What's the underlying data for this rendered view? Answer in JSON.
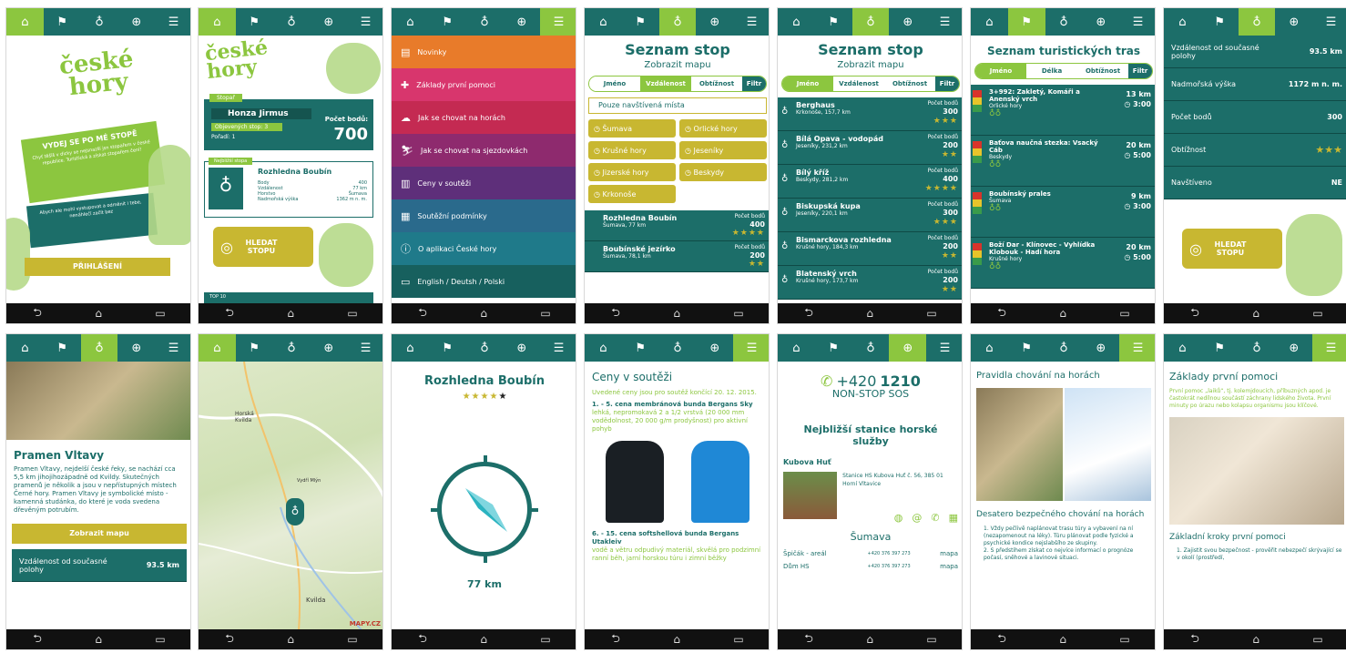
{
  "nav": {
    "icons": [
      "home-icon",
      "tracks-icon",
      "footprint-icon",
      "rescue-icon",
      "menu-icon"
    ]
  },
  "s1": {
    "logo": "české hory",
    "headline": "VYDEJ SE PO MÉ STOPĚ",
    "text1": "Chyť těšíš v dicky se nejsnazší jsn stopařem v české republice. Turistická a získat stopařem čení!",
    "text2": "Abych ale mohl vystupovat a odměnit i tebe, nenáhlečí začít bez",
    "login": "PŘIHLÁŠENÍ"
  },
  "s2": {
    "logo": "české hory",
    "section": "Stopař",
    "name": "Honza Jirmus",
    "found_label": "Objevených stop: 3",
    "rank_label": "Pořadí: 1",
    "points_label": "Počet bodů:",
    "points": "700",
    "card_tag": "Nejbližší stopa",
    "place": "Rozhledna Boubín",
    "rows": [
      [
        "Body",
        "400"
      ],
      [
        "Vzdálenost",
        "77 km"
      ],
      [
        "Horstvo",
        "Šumava"
      ],
      [
        "Nadmořská výška",
        "1362 m n. m."
      ]
    ],
    "search": "HLEDAT STOPU",
    "top": "TOP 10"
  },
  "s3": {
    "menu": [
      {
        "label": "Novinky",
        "color": "#e87b2a"
      },
      {
        "label": "Základy první pomoci",
        "color": "#d8366d"
      },
      {
        "label": "Jak se chovat na horách",
        "color": "#c42a52"
      },
      {
        "label": "Jak se chovat na sjezdovkách",
        "color": "#8e2a6e"
      },
      {
        "label": "Ceny v soutěži",
        "color": "#5e2f7a"
      },
      {
        "label": "Soutěžní podmínky",
        "color": "#2a6a8c"
      },
      {
        "label": "O aplikaci České hory",
        "color": "#1f7a8a"
      },
      {
        "label": "English / Deutsh / Polski",
        "color": "#17605e"
      }
    ]
  },
  "s4": {
    "title": "Seznam stop",
    "map": "Zobrazit mapu",
    "tabs": [
      "Jméno",
      "Vzdálenost",
      "Obtížnost",
      "Filtr"
    ],
    "visited": "Pouze navštívená místa",
    "chips": [
      "Šumava",
      "Orlické hory",
      "Krušné hory",
      "Jeseníky",
      "Jizerské hory",
      "Beskydy",
      "Krkonoše"
    ],
    "items": [
      {
        "name": "Rozhledna Boubín",
        "sub": "Šumava, 77 km",
        "pts_label": "Počet bodů",
        "pts": "400"
      },
      {
        "name": "Boubínské jezírko",
        "sub": "Šumava, 78,1 km",
        "pts_label": "Počet bodů",
        "pts": "200"
      }
    ]
  },
  "s5": {
    "title": "Seznam stop",
    "map": "Zobrazit mapu",
    "tabs": [
      "Jméno",
      "Vzdálenost",
      "Obtížnost",
      "Filtr"
    ],
    "items": [
      {
        "name": "Berghaus",
        "sub": "Krkonoše, 157,7 km",
        "pts_label": "Počet bodů",
        "pts": "300"
      },
      {
        "name": "Bílá Opava - vodopád",
        "sub": "Jeseníky, 231,2 km",
        "pts_label": "Počet bodů",
        "pts": "200"
      },
      {
        "name": "Bílý kříž",
        "sub": "Beskydy, 281,2 km",
        "pts_label": "Počet bodů",
        "pts": "400"
      },
      {
        "name": "Biskupská kupa",
        "sub": "Jeseníky, 220,1 km",
        "pts_label": "Počet bodů",
        "pts": "300"
      },
      {
        "name": "Bismarckova rozhledna",
        "sub": "Krušné hory, 184,3 km",
        "pts_label": "Počet bodů",
        "pts": "200"
      },
      {
        "name": "Blatenský vrch",
        "sub": "Krušné hory, 173,7 km",
        "pts_label": "Počet bodů",
        "pts": "200"
      }
    ]
  },
  "s6": {
    "title": "Seznam turistických tras",
    "tabs": [
      "Jméno",
      "Délka",
      "Obtížnost",
      "Filtr"
    ],
    "items": [
      {
        "name": "3+992: Zakletý, Komáři a Anenský vrch",
        "sub": "Orlické hory",
        "km": "13 km",
        "time": "3:00"
      },
      {
        "name": "Baťova naučná stezka: Vsacký Cáb",
        "sub": "Beskydy",
        "km": "20 km",
        "time": "5:00"
      },
      {
        "name": "Boubínský prales",
        "sub": "Šumava",
        "km": "9 km",
        "time": "3:00"
      },
      {
        "name": "Boží Dar - Klínovec - Vyhlídka Klobouk - Hadí hora",
        "sub": "Krušné hory",
        "km": "20 km",
        "time": "5:00"
      }
    ]
  },
  "s7": {
    "rows": [
      [
        "Vzdálenost od současné polohy",
        "93.5 km"
      ],
      [
        "Nadmořská výška",
        "1172 m n. m."
      ],
      [
        "Počet bodů",
        "300"
      ],
      [
        "Obtížnost",
        "★★★"
      ],
      [
        "Navštíveno",
        "NE"
      ]
    ],
    "search": "HLEDAT STOPU"
  },
  "s8": {
    "title": "Pramen Vltavy",
    "text": "Pramen Vltavy, nejdelší české řeky, se nachází cca 5,5 km jihojihozápadně od Kvildy. Skutečných pramenů je několik a jsou v nepřístupných místech Černé hory. Pramen Vltavy je symbolické místo - kamenná studánka, do které je voda svedena dřevěným potrubím.",
    "map_btn": "Zobrazit mapu",
    "row_label": "Vzdálenost od současné polohy",
    "row_val": "93.5 km"
  },
  "s9": {
    "labels": [
      "Horská Kvilda",
      "Kvilda",
      "Vydří Mlýn"
    ],
    "brand": "MAPY.CZ"
  },
  "s10": {
    "title": "Rozhledna Boubín",
    "stars": "★★★★",
    "star_empty": "★",
    "distance": "77 km"
  },
  "s11": {
    "title": "Ceny v soutěži",
    "intro": "Uvedené ceny jsou pro soutěž končící 20. 12. 2015.",
    "p1_title": "1. - 5. cena membránová bunda Bergans Sky",
    "p1_text": "lehká, nepromokavá 2 a 1/2 vrstvá (20 000 mm vodědolnost, 20 000 g/m prodyšnost) pro aktivní pohyb",
    "p2_title": "6. - 15. cena softshellová bunda Bergans Utakleiv",
    "p2_text": "vodě a větru odpudivý materiál, skvělá pro podzimní ranní běh, jarní horskou túru i zimní běžky"
  },
  "s12": {
    "phone_prefix": "+420",
    "phone_num": "1210",
    "sos": "NON-STOP SOS",
    "heading": "Nejbližší stanice horské služby",
    "station": "Kubova Huť",
    "address": "Stanice HS Kubova Huť č. 56, 385 01 Horní Vltavice",
    "region": "Šumava",
    "rows": [
      [
        "Špičák - areál",
        "+420 376 397 273",
        "mapa"
      ],
      [
        "Dům HS",
        "+420 376 397 273",
        "mapa"
      ]
    ]
  },
  "s13": {
    "title": "Pravidla chování na horách",
    "heading": "Desatero bezpečného chování na horách",
    "items": [
      "1. Vždy pečlivě naplánovat trasu túry a vybavení na ní (nezapomenout na léky). Túru plánovat podle fyzické a psychické kondice nejslabšího ze skupiny.",
      "2. S předstihem získat co nejvíce informací o prognóze počasí, sněhové a lavinové situaci."
    ]
  },
  "s14": {
    "title": "Základy první pomoci",
    "text": "První pomoc „laiků“, tj. kolemjdoucích, příbuzných apod. je častokrát nedílnou součástí záchrany lidského života. První minuty po úrazu nebo kolapsu organismu jsou klíčové.",
    "heading": "Základní kroky první pomoci",
    "item": "1. Zajistit svou bezpečnost - prověřit nebezpečí skrývající se v okolí (prostředí,"
  }
}
